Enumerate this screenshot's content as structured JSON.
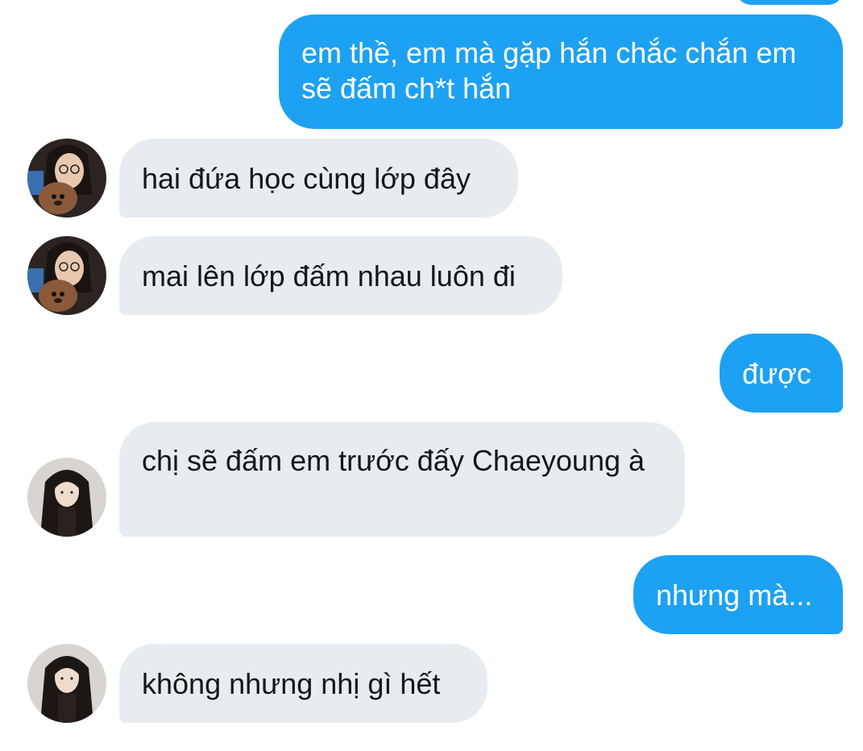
{
  "colors": {
    "outgoing_bubble": "#1da1f2",
    "incoming_bubble": "#e6ecf0",
    "outgoing_text": "#ffffff",
    "incoming_text": "#14171a"
  },
  "messages": [
    {
      "direction": "outgoing",
      "text": "em thề, em mà gặp hắn chắc chắn em sẽ đấm ch*t hắn"
    },
    {
      "direction": "incoming",
      "sender_avatar": "avatar-girl-with-dog",
      "text": "hai đứa học cùng lớp đây"
    },
    {
      "direction": "incoming",
      "sender_avatar": "avatar-girl-with-dog",
      "text": "mai lên lớp đấm nhau luôn đi"
    },
    {
      "direction": "outgoing",
      "text": "được"
    },
    {
      "direction": "incoming",
      "sender_avatar": "avatar-girl-long-hair",
      "text": "chị sẽ đấm em trước đấy Chaeyoung à"
    },
    {
      "direction": "outgoing",
      "text": "nhưng mà..."
    },
    {
      "direction": "incoming",
      "sender_avatar": "avatar-girl-long-hair",
      "text": "không nhưng nhị gì hết"
    }
  ]
}
